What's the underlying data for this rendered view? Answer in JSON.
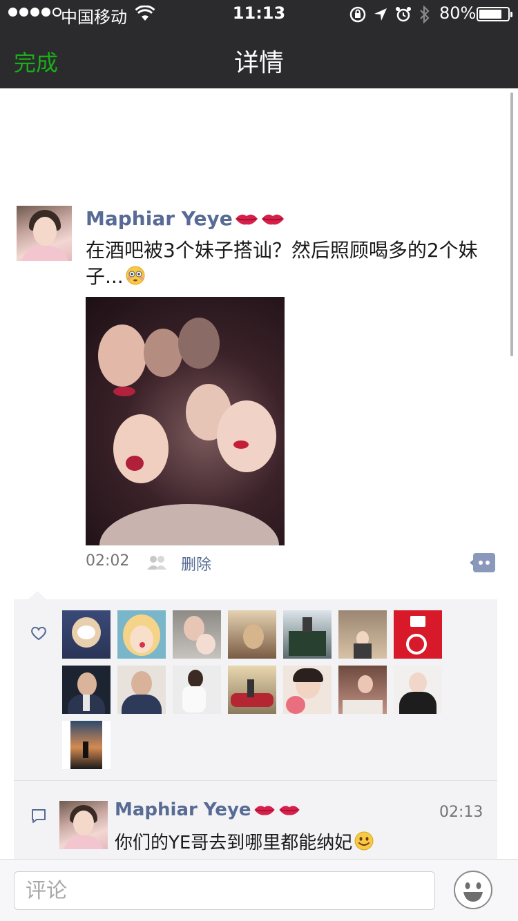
{
  "status_bar": {
    "carrier": "中国移动",
    "time": "11:13",
    "battery_percent": "80%",
    "battery_level": 0.8
  },
  "nav": {
    "done_label": "完成",
    "title": "详情"
  },
  "post": {
    "author": "Maphiar Yeye",
    "text": "在酒吧被3个妹子搭讪？然后照顾喝多的2个妹子...",
    "time": "02:02",
    "delete_label": "删除"
  },
  "likes": {
    "count": 15
  },
  "comments": [
    {
      "author": "Maphiar Yeye",
      "text": "你们的YE哥去到哪里都能纳妃",
      "time": "02:13"
    }
  ],
  "input": {
    "placeholder": "评论"
  },
  "colors": {
    "nav_bg": "#2b2b2d",
    "accent_green": "#1aad19",
    "link_blue": "#576b95",
    "panel_bg": "#f3f3f5"
  },
  "icons": [
    "wifi-icon",
    "orientation-lock-icon",
    "location-arrow-icon",
    "alarm-icon",
    "bluetooth-icon",
    "battery-icon",
    "lips-emoji-icon",
    "flushed-emoji-icon",
    "friends-icon",
    "more-icon",
    "heart-icon",
    "comment-icon",
    "smile-emoji-icon",
    "emoji-keyboard-icon"
  ]
}
